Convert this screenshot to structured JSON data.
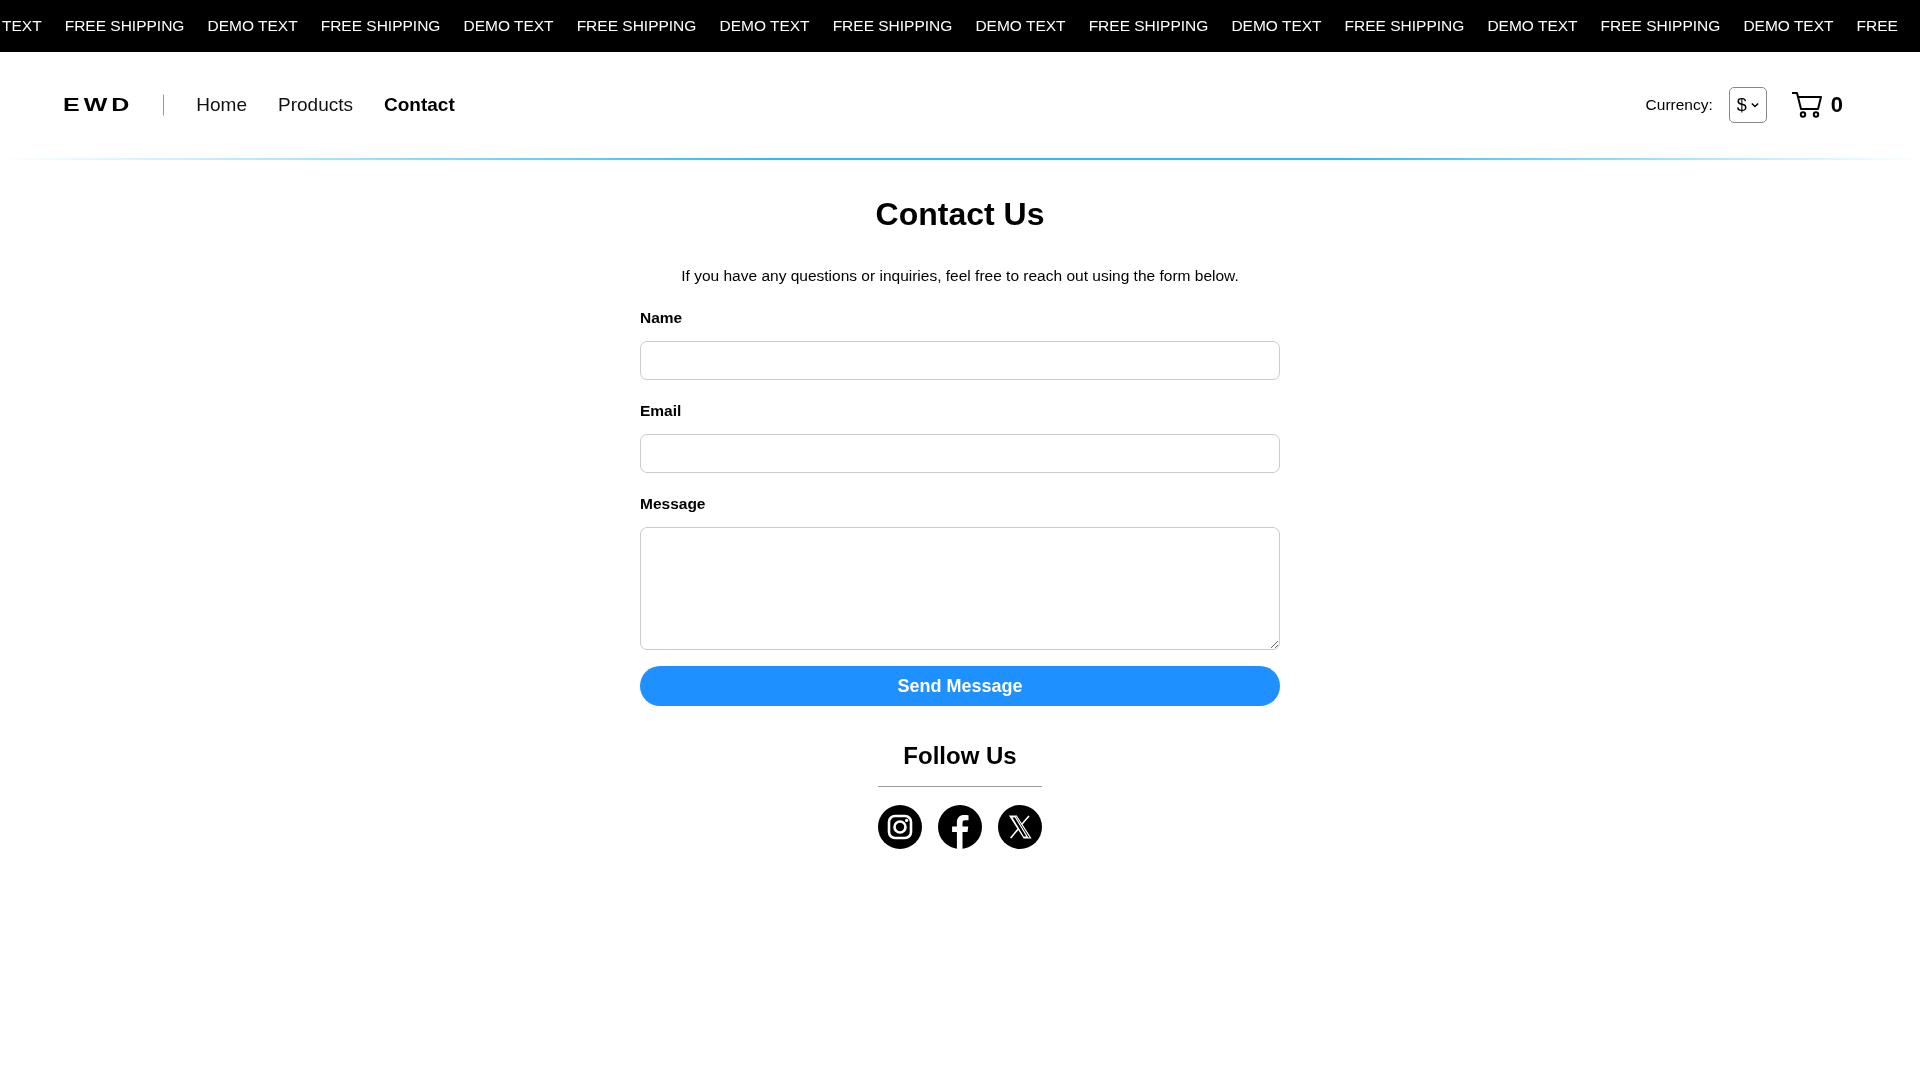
{
  "ticker": [
    "TEXT",
    "FREE SHIPPING",
    "DEMO TEXT",
    "FREE SHIPPING",
    "DEMO TEXT",
    "FREE SHIPPING",
    "DEMO TEXT",
    "FREE SHIPPING",
    "DEMO TEXT",
    "FREE SHIPPING",
    "DEMO TEXT",
    "FREE SHIPPING",
    "DEMO TEXT",
    "FREE SHIPPING",
    "DEMO TEXT",
    "FREE"
  ],
  "header": {
    "logo": "EWD",
    "nav": [
      {
        "label": "Home",
        "selected": false
      },
      {
        "label": "Products",
        "selected": false
      },
      {
        "label": "Contact",
        "selected": true
      }
    ],
    "currency_label": "Currency:",
    "currency_value": "$",
    "cart_count": "0"
  },
  "contact": {
    "title": "Contact Us",
    "intro": "If you have any questions or inquiries, feel free to reach out using the form below.",
    "fields": [
      {
        "label": "Name",
        "kind": "input"
      },
      {
        "label": "Email",
        "kind": "input"
      },
      {
        "label": "Message",
        "kind": "textarea"
      }
    ],
    "submit": "Send Message"
  },
  "follow": {
    "title": "Follow Us"
  }
}
